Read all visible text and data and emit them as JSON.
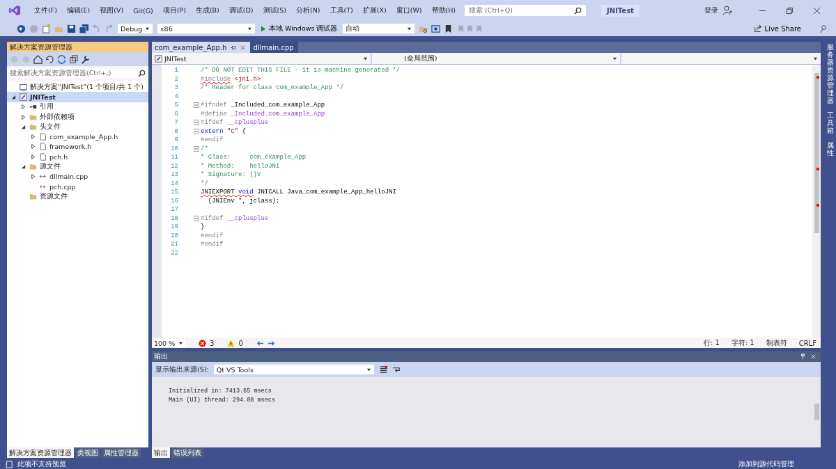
{
  "window": {
    "menu": [
      "文件(F)",
      "编辑(E)",
      "视图(V)",
      "Git(G)",
      "项目(P)",
      "生成(B)",
      "调试(D)",
      "测试(S)",
      "分析(N)",
      "工具(T)",
      "扩展(X)",
      "窗口(W)",
      "帮助(H)"
    ],
    "search": {
      "placeholder": "搜索 (Ctrl+Q)"
    },
    "title": "JNITest",
    "sign_in": "登录"
  },
  "toolbar": {
    "config": "Debug",
    "platform": "x86",
    "run": "本地 Windows 调试器",
    "run_target": "自动",
    "live_share": "Live Share"
  },
  "solution_explorer": {
    "title": "解决方案资源管理器",
    "search": {
      "placeholder": "搜索解决方案资源管理器(Ctrl+;)"
    },
    "tree": [
      {
        "label": "解决方案“JNITest”(1 个项目/共 1 个)",
        "kind": "solution",
        "selected": false
      },
      {
        "label": "JNITest",
        "kind": "project",
        "selected": true,
        "expanded": true,
        "children": [
          {
            "label": "引用",
            "kind": "reference",
            "selected": false,
            "expanded": false
          },
          {
            "label": "外部依赖项",
            "kind": "external",
            "selected": false,
            "expanded": false
          },
          {
            "label": "头文件",
            "kind": "folder",
            "selected": false,
            "expanded": true,
            "children": [
              {
                "label": "com_example_App.h",
                "kind": "header",
                "selected": false,
                "expanded": false
              },
              {
                "label": "framework.h",
                "kind": "header",
                "selected": false,
                "expanded": false
              },
              {
                "label": "pch.h",
                "kind": "header",
                "selected": false,
                "expanded": false
              }
            ]
          },
          {
            "label": "源文件",
            "kind": "folder",
            "selected": false,
            "expanded": true,
            "children": [
              {
                "label": "dllmain.cpp",
                "kind": "source",
                "selected": false,
                "expanded": false
              },
              {
                "label": "pch.cpp",
                "kind": "source",
                "selected": false
              }
            ]
          },
          {
            "label": "资源文件",
            "kind": "folder",
            "selected": false
          }
        ]
      }
    ],
    "tabs": [
      {
        "label": "解决方案资源管理器",
        "selected": true
      },
      {
        "label": "类视图",
        "selected": false
      },
      {
        "label": "属性管理器",
        "selected": false
      }
    ]
  },
  "editor": {
    "tabs": [
      {
        "label": "com_example_App.h",
        "selected": true
      },
      {
        "label": "dllmain.cpp",
        "selected": false
      }
    ],
    "nav": {
      "project": "JNITest",
      "scope": "(全局范围)"
    },
    "lines": [
      {
        "number": "1",
        "fold": false,
        "segments": [
          {
            "text": "/* DO NOT EDIT THIS FILE - it is machine generated */",
            "kind": "comment",
            "error": false
          }
        ]
      },
      {
        "number": "2",
        "fold": false,
        "segments": [
          {
            "text": "#include",
            "kind": "preproc",
            "error": true
          },
          {
            "text": " <jni.h>",
            "kind": "string",
            "error": false
          }
        ]
      },
      {
        "number": "3",
        "fold": false,
        "segments": [
          {
            "text": "/* Header for class com_example_App */",
            "kind": "comment",
            "error": false
          }
        ]
      },
      {
        "number": "4",
        "fold": false
      },
      {
        "number": "5",
        "fold": true,
        "segments": [
          {
            "text": "#ifndef",
            "kind": "preproc",
            "error": false
          },
          {
            "text": " _Included_com_example_App",
            "kind": "plain",
            "error": false
          }
        ]
      },
      {
        "number": "6",
        "fold": false,
        "segments": [
          {
            "text": "#define ",
            "kind": "preproc",
            "error": false
          },
          {
            "text": "_Included_com_example_App",
            "kind": "macro",
            "error": false
          }
        ]
      },
      {
        "number": "7",
        "fold": true,
        "segments": [
          {
            "text": "#ifdef ",
            "kind": "preproc",
            "error": false
          },
          {
            "text": "__cplusplus",
            "kind": "macro",
            "error": false
          }
        ]
      },
      {
        "number": "8",
        "fold": true,
        "segments": [
          {
            "text": "extern",
            "kind": "keyword",
            "error": false
          },
          {
            "text": " \"C\"",
            "kind": "string",
            "error": false
          },
          {
            "text": " {",
            "kind": "plain",
            "error": false
          }
        ]
      },
      {
        "number": "9",
        "fold": false,
        "segments": [
          {
            "text": "#endif",
            "kind": "preproc",
            "error": false
          }
        ]
      },
      {
        "number": "10",
        "fold": true,
        "segments": [
          {
            "text": "/*",
            "kind": "comment",
            "error": false
          }
        ]
      },
      {
        "number": "11",
        "fold": false,
        "segments": [
          {
            "text": "* Class:     com_example_App",
            "kind": "comment",
            "error": false
          }
        ]
      },
      {
        "number": "12",
        "fold": false,
        "segments": [
          {
            "text": "* Method:    helloJNI",
            "kind": "comment",
            "error": false
          }
        ]
      },
      {
        "number": "13",
        "fold": false,
        "segments": [
          {
            "text": "* Signature: ()V",
            "kind": "comment",
            "error": false
          }
        ]
      },
      {
        "number": "14",
        "fold": false,
        "segments": [
          {
            "text": "*/",
            "kind": "comment",
            "error": false
          }
        ]
      },
      {
        "number": "15",
        "fold": false,
        "segments": [
          {
            "text": "JNIEXPORT",
            "kind": "plain",
            "error": true
          },
          {
            "text": " void",
            "kind": "keyword",
            "error": true
          },
          {
            "text": " JNICALL Java_com_example_App_helloJNI",
            "kind": "plain",
            "error": false
          }
        ]
      },
      {
        "number": "16",
        "fold": false,
        "segments": [
          {
            "text": "  (JNIEnv *, jclass);",
            "kind": "plain",
            "error": false
          }
        ]
      },
      {
        "number": "17",
        "fold": false
      },
      {
        "number": "18",
        "fold": true,
        "segments": [
          {
            "text": "#ifdef ",
            "kind": "preproc",
            "error": false
          },
          {
            "text": "__cplusplus",
            "kind": "macro",
            "error": false
          }
        ]
      },
      {
        "number": "19",
        "fold": false,
        "segments": [
          {
            "text": "}",
            "kind": "plain",
            "error": false
          }
        ]
      },
      {
        "number": "20",
        "fold": false,
        "segments": [
          {
            "text": "#endif",
            "kind": "preproc",
            "error": false
          }
        ]
      },
      {
        "number": "21",
        "fold": false,
        "segments": [
          {
            "text": "#endif",
            "kind": "preproc",
            "error": false
          }
        ]
      },
      {
        "number": "22",
        "fold": false
      }
    ],
    "zoom": "100 %",
    "errors": "3",
    "warnings": "0",
    "status": [
      "行: 1",
      "字符: 1",
      "制表符",
      "CRLF"
    ]
  },
  "output": {
    "title": "输出",
    "source_label": "显示输出来源(S):",
    "source": "Qt VS Tools",
    "lines": [
      "Initialized in: 7413.65 msecs",
      "Main (UI) thread: 294.08 msecs"
    ],
    "tabs": [
      {
        "label": "输出",
        "selected": true
      },
      {
        "label": "错误列表",
        "selected": false
      }
    ]
  },
  "side_tabs": [
    "服务器资源管理器",
    "工具箱",
    "属性"
  ],
  "status_bar": {
    "message": "此项不支持预览",
    "source_control": "添加到源代码管理"
  }
}
